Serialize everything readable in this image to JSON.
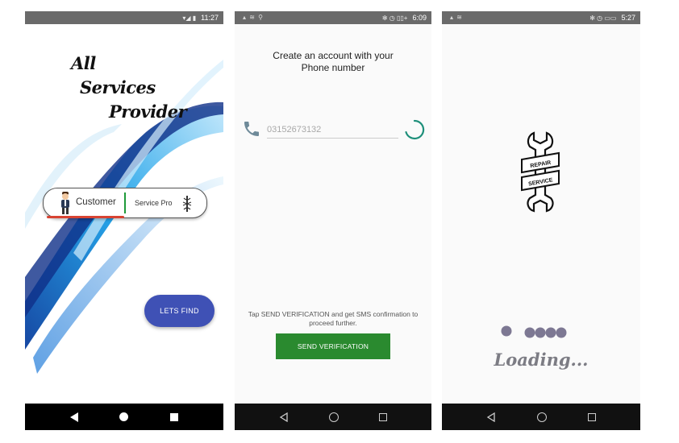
{
  "screen1": {
    "status_time": "11:27",
    "title_lines": [
      "All",
      "Services",
      "Provider"
    ],
    "toggle": {
      "option1": "Customer",
      "option2": "Service Pro"
    },
    "fab_label": "LETS FIND"
  },
  "screen2": {
    "status_time": "6:09",
    "status_icons": "✻ ◷ ▯▯+",
    "heading_line1": "Create an account with your",
    "heading_line2": "Phone number",
    "phone_value": "03152673132",
    "hint": "Tap SEND VERIFICATION and get SMS confirmation to proceed further.",
    "button_label": "SEND VERIFICATION"
  },
  "screen3": {
    "status_time": "5:27",
    "status_icons": "✻ ◷ ▭▭",
    "logo_text_top": "REPAIR",
    "logo_text_bottom": "SERVICE",
    "loading_label": "Loading..."
  },
  "colors": {
    "fab": "#3f51b5",
    "send_button": "#2a8a2f",
    "toggle_divider": "#1f9a3a",
    "toggle_underline": "#d84332",
    "spinner": "#1e8f7a",
    "loading_text": "#7c7c84"
  }
}
